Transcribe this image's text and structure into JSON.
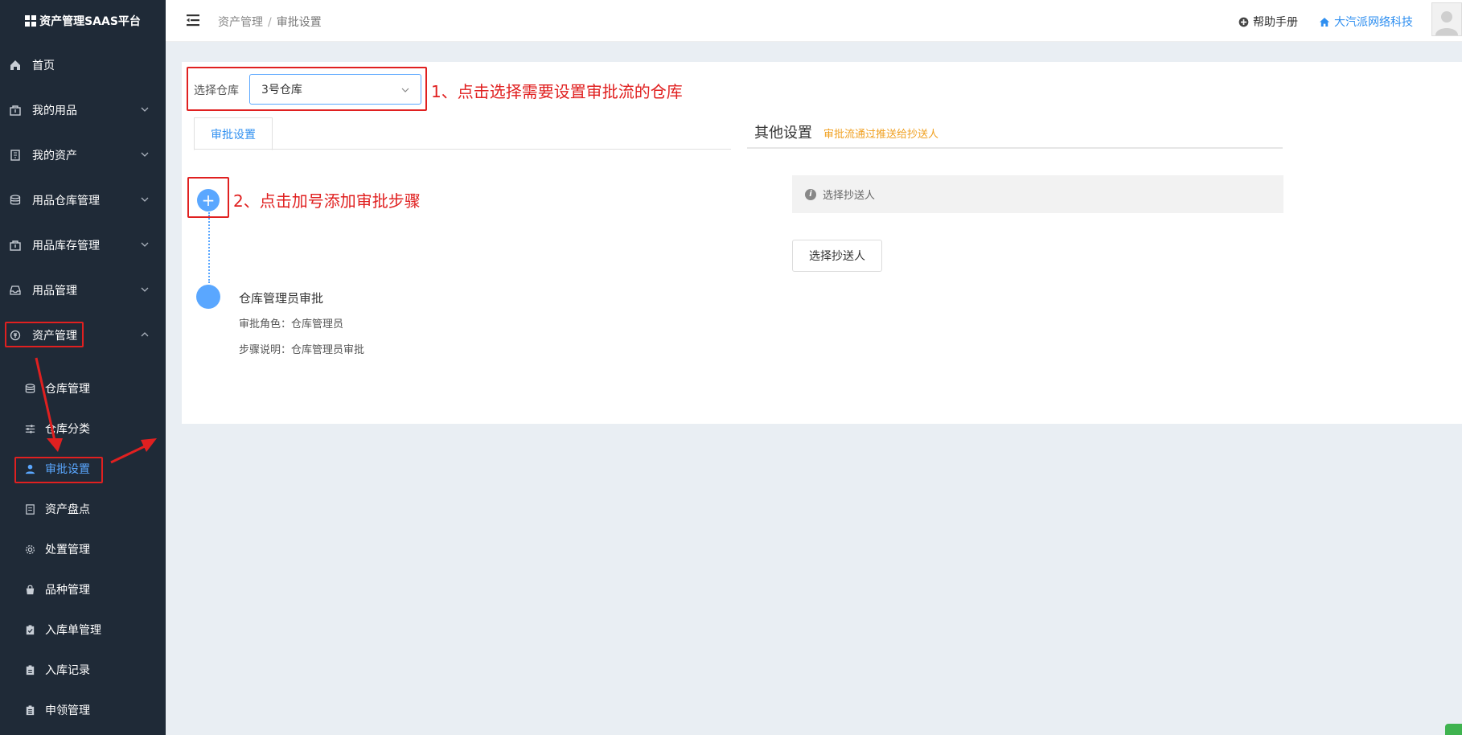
{
  "app": {
    "title": "资产管理SAAS平台"
  },
  "sidebar": {
    "items": [
      {
        "label": "首页",
        "icon": "home-icon"
      },
      {
        "label": "我的用品",
        "icon": "bag-icon"
      },
      {
        "label": "我的资产",
        "icon": "building-icon"
      },
      {
        "label": "用品仓库管理",
        "icon": "database-icon"
      },
      {
        "label": "用品库存管理",
        "icon": "box-icon"
      },
      {
        "label": "用品管理",
        "icon": "inbox-icon"
      },
      {
        "label": "资产管理",
        "icon": "asset-icon"
      }
    ],
    "subitems": [
      {
        "label": "仓库管理",
        "icon": "database-icon"
      },
      {
        "label": "仓库分类",
        "icon": "sliders-icon"
      },
      {
        "label": "审批设置",
        "icon": "user-icon"
      },
      {
        "label": "资产盘点",
        "icon": "document-icon"
      },
      {
        "label": "处置管理",
        "icon": "gear-icon"
      },
      {
        "label": "品种管理",
        "icon": "shopping-bag-icon"
      },
      {
        "label": "入库单管理",
        "icon": "clipboard-check-icon"
      },
      {
        "label": "入库记录",
        "icon": "clipboard-icon"
      },
      {
        "label": "申领管理",
        "icon": "clipboard-list-icon"
      }
    ]
  },
  "header": {
    "breadcrumb": {
      "parent": "资产管理",
      "separator": "/",
      "current": "审批设置"
    },
    "help_label": "帮助手册",
    "company_label": "大汽派网络科技"
  },
  "main": {
    "warehouse_label": "选择仓库",
    "warehouse_value": "3号仓库",
    "tab_label": "审批设置",
    "other_title": "其他设置",
    "other_hint": "审批流通过推送给抄送人",
    "step": {
      "title": "仓库管理员审批",
      "role_label": "审批角色：",
      "role_value": "仓库管理员",
      "desc_label": "步骤说明：",
      "desc_value": "仓库管理员审批"
    },
    "cc_placeholder": "选择抄送人",
    "cc_button": "选择抄送人"
  },
  "annotations": {
    "step1": "1、点击选择需要设置审批流的仓库",
    "step2": "2、点击加号添加审批步骤"
  },
  "colors": {
    "accent": "#2f8ff0",
    "sidebar_bg": "#1f2a37",
    "annotation": "#e02020",
    "hint": "#f0a020"
  }
}
